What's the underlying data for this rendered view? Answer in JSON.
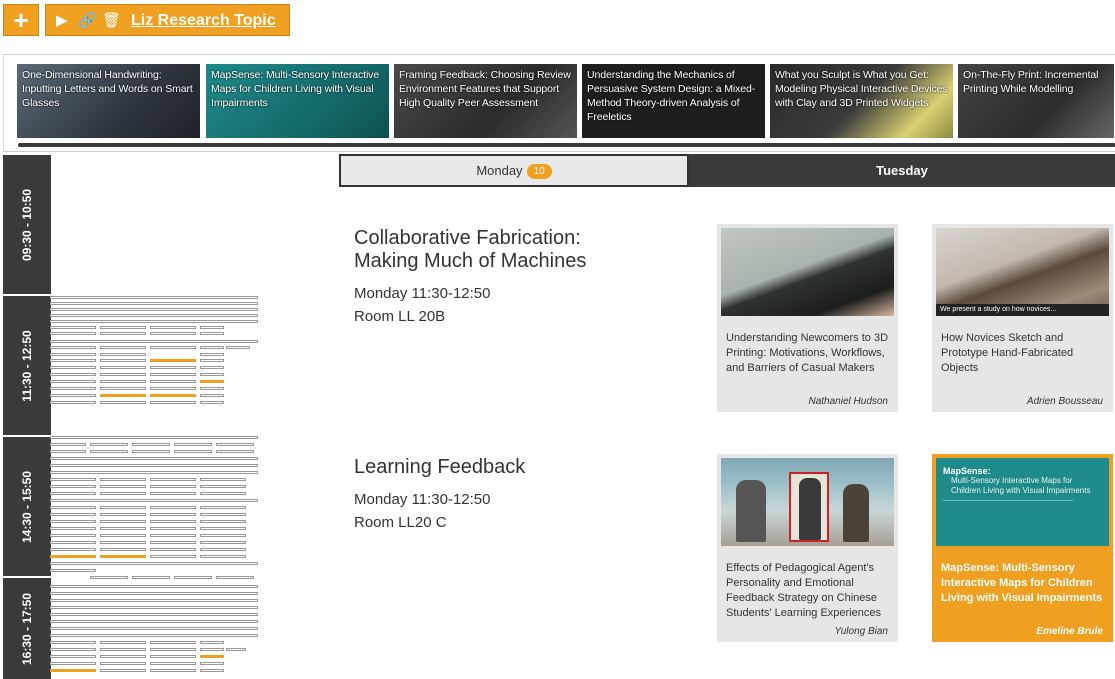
{
  "toolbar": {
    "add_label": "+",
    "topic_title": "Liz Research Topic",
    "icons": [
      "play-icon",
      "link-icon",
      "trash-icon"
    ]
  },
  "carousel": [
    {
      "title": "One-Dimensional Handwriting: Inputting Letters and Words on Smart Glasses"
    },
    {
      "title": "MapSense: Multi-Sensory Interactive Maps for Children Living with Visual Impairments"
    },
    {
      "title": "Framing Feedback: Choosing Review Environment Features that Support High Quality Peer Assessment"
    },
    {
      "title": "Understanding the Mechanics of Persuasive System Design: a Mixed-Method Theory-driven Analysis of Freeletics"
    },
    {
      "title": "What you Sculpt is What you Get: Modeling Physical Interactive Devices with Clay and 3D Printed Widgets"
    },
    {
      "title": "On-The-Fly Print: Incremental Printing While Modelling"
    }
  ],
  "days": {
    "monday": {
      "label": "Monday",
      "count": "10"
    },
    "tuesday": {
      "label": "Tuesday"
    }
  },
  "time_slots": [
    "09:30 - 10:50",
    "11:30 - 12:50",
    "14:30 - 15:50",
    "16:30 - 17:50"
  ],
  "sessions": [
    {
      "title_line1": "Collaborative Fabrication:",
      "title_line2": "Making Much of Machines",
      "time": "Monday 11:30-12:50",
      "room": "Room LL 20B",
      "papers": [
        {
          "title": "Understanding Newcomers to 3D Printing: Motivations, Workflows, and Barriers of Casual Makers",
          "author": "Nathaniel Hudson"
        },
        {
          "title": "How Novices Sketch and Prototype Hand-Fabricated Objects",
          "author": "Adrien Bousseau",
          "caption": "We present a study on how novices..."
        }
      ]
    },
    {
      "title_line1": "Learning Feedback",
      "time": "Monday 11:30-12:50",
      "room": "Room LL20 C",
      "papers": [
        {
          "title": "Effects of Pedagogical Agent's Personality and Emotional Feedback Strategy on Chinese Students' Learning Experiences",
          "author": "Yulong Bian"
        },
        {
          "title": "MapSense: Multi-Sensory Interactive Maps for Children Living with Visual Impairments",
          "author": "Emeline Brule",
          "image_heading": "MapSense:",
          "image_subheading": "Multi-Sensory Interactive Maps for Children Living with Visual Impairments"
        }
      ]
    }
  ],
  "colors": {
    "accent": "#f0a020",
    "dark": "#3a3a3a",
    "card": "#e6e6e6"
  }
}
